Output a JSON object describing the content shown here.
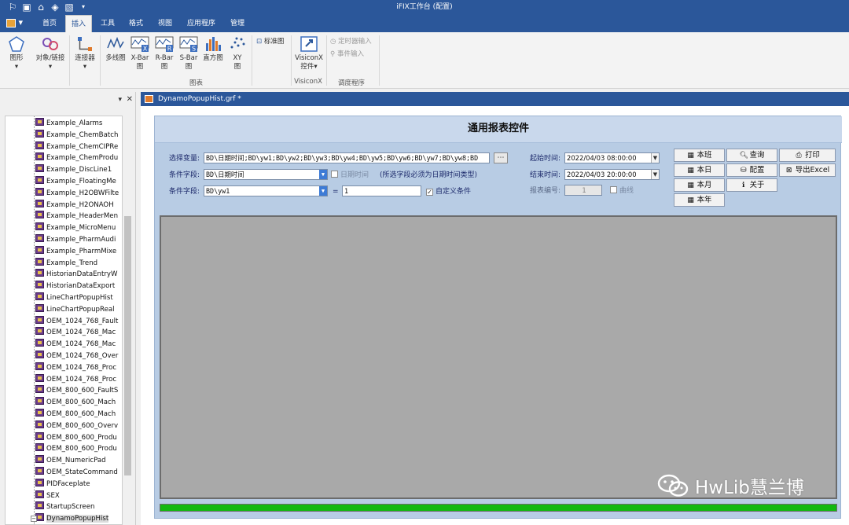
{
  "app_title": "iFIX工作台 (配置)",
  "menu_tabs": [
    "首页",
    "插入",
    "工具",
    "格式",
    "视图",
    "应用程序",
    "管理"
  ],
  "active_tab": "插入",
  "ribbon": {
    "shapes": "图形",
    "objects_links": "对象/链接",
    "connector": "连接器",
    "multiline": "多线图",
    "xbar_1": "X-Bar",
    "xbar_2": "图",
    "rbar_1": "R-Bar",
    "rbar_2": "图",
    "sbar_1": "S-Bar",
    "sbar_2": "图",
    "histogram": "直方图",
    "xy_1": "XY",
    "xy_2": "图",
    "standard_chart": "标准图",
    "group_charts": "图表",
    "visiconx_1": "VisiconX",
    "visiconx_2": "控件",
    "group_visiconx": "VisiconX",
    "timer_input": "定时器输入",
    "event_input": "事件输入",
    "group_scheduler": "调度程序"
  },
  "tree_items": [
    "Example_Alarms",
    "Example_ChemBatch",
    "Example_ChemCIPRe",
    "Example_ChemProdu",
    "Example_DiscLine1",
    "Example_FloatingMe",
    "Example_H2OBWFilte",
    "Example_H2ONAOH",
    "Example_HeaderMen",
    "Example_MicroMenu",
    "Example_PharmAudi",
    "Example_PharmMixe",
    "Example_Trend",
    "HistorianDataEntryW",
    "HistorianDataExport",
    "LineChartPopupHist",
    "LineChartPopupReal",
    "OEM_1024_768_Fault",
    "OEM_1024_768_Mac",
    "OEM_1024_768_Mac",
    "OEM_1024_768_Over",
    "OEM_1024_768_Proc",
    "OEM_1024_768_Proc",
    "OEM_800_600_FaultS",
    "OEM_800_600_Mach",
    "OEM_800_600_Mach",
    "OEM_800_600_Overv",
    "OEM_800_600_Produ",
    "OEM_800_600_Produ",
    "OEM_NumericPad",
    "OEM_StateCommand",
    "PIDFaceplate",
    "SEX",
    "StartupScreen",
    "DynamoPopupHist"
  ],
  "doc_tab": "DynamoPopupHist.grf *",
  "form": {
    "title": "通用报表控件",
    "select_var_label": "选择变量:",
    "select_var_value": "BD\\日期时间;BD\\yw1;BD\\yw2;BD\\yw3;BD\\yw4;BD\\yw5;BD\\yw6;BD\\yw7;BD\\yw8;BD",
    "browse_btn": "⋯",
    "cond_field_label": "条件字段:",
    "cond_field_value": "BD\\日期时间",
    "datetime_chk": "日期时间",
    "datetime_note": "(所选字段必须为日期时间类型)",
    "cond_field2_label": "条件字段:",
    "cond_field2_value": "BD\\yw1",
    "equals": "=",
    "cond_value": "1",
    "custom_chk": "自定义条件",
    "start_label": "起始时间:",
    "start_value": "2022/04/03 08:00:00",
    "end_label": "结束时间:",
    "end_value": "2022/04/03 20:00:00",
    "report_no_label": "报表编号:",
    "report_no_value": "1",
    "curve_chk": "曲线",
    "btn_shift": "本班",
    "btn_query": "查询",
    "btn_print": "打印",
    "btn_day": "本日",
    "btn_config": "配置",
    "btn_export": "导出Excel",
    "btn_month": "本月",
    "btn_about": "关于",
    "btn_year": "本年",
    "progress": 1.0,
    "progress_color": "#12b80f"
  },
  "watermark": "HwLib慧兰博",
  "colors": {
    "title_bar": "#2b579a",
    "form_bg": "#b8cce4",
    "grid_bg": "#a9a9a9"
  }
}
